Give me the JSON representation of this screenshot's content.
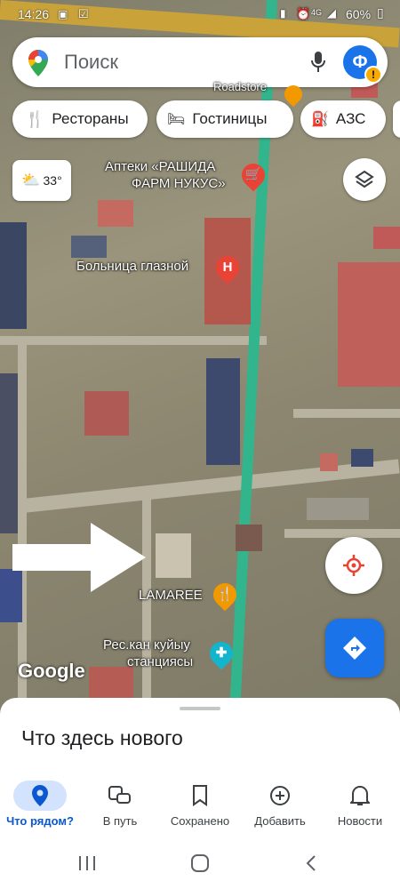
{
  "status_bar": {
    "time": "14:26",
    "battery": "60%"
  },
  "search": {
    "placeholder": "Поиск",
    "avatar_letter": "Ф"
  },
  "chips": [
    {
      "label": "Рестораны",
      "icon": "fork-knife-icon"
    },
    {
      "label": "Гостиницы",
      "icon": "bed-icon"
    },
    {
      "label": "АЗС",
      "icon": "gas-pump-icon"
    }
  ],
  "weather": {
    "temperature": "33°",
    "icon": "partly-sunny-icon"
  },
  "map_labels": {
    "pharmacy_line1": "Аптеки «РАШИДА",
    "pharmacy_line2": "ФАРМ НУКУС»",
    "hospital": "Больница глазной",
    "restaurant": "LAMAREE",
    "station_line1": "Рес.кан куйыу",
    "station_line2": "станциясы",
    "top_partial": "Roadstore",
    "google": "Google"
  },
  "colors": {
    "accent_blue": "#1a73e8",
    "directions_blue": "#1a73e8",
    "pin_red": "#ea4335",
    "pin_orange": "#f29900",
    "pin_teal": "#12b5cb"
  },
  "sheet": {
    "title": "Что здесь нового"
  },
  "bottom_nav": [
    {
      "label": "Что рядом?",
      "icon": "location-pin-icon",
      "active": true
    },
    {
      "label": "В путь",
      "icon": "commute-icon",
      "active": false
    },
    {
      "label": "Сохранено",
      "icon": "bookmark-icon",
      "active": false
    },
    {
      "label": "Добавить",
      "icon": "add-circle-icon",
      "active": false
    },
    {
      "label": "Новости",
      "icon": "bell-icon",
      "active": false
    }
  ]
}
